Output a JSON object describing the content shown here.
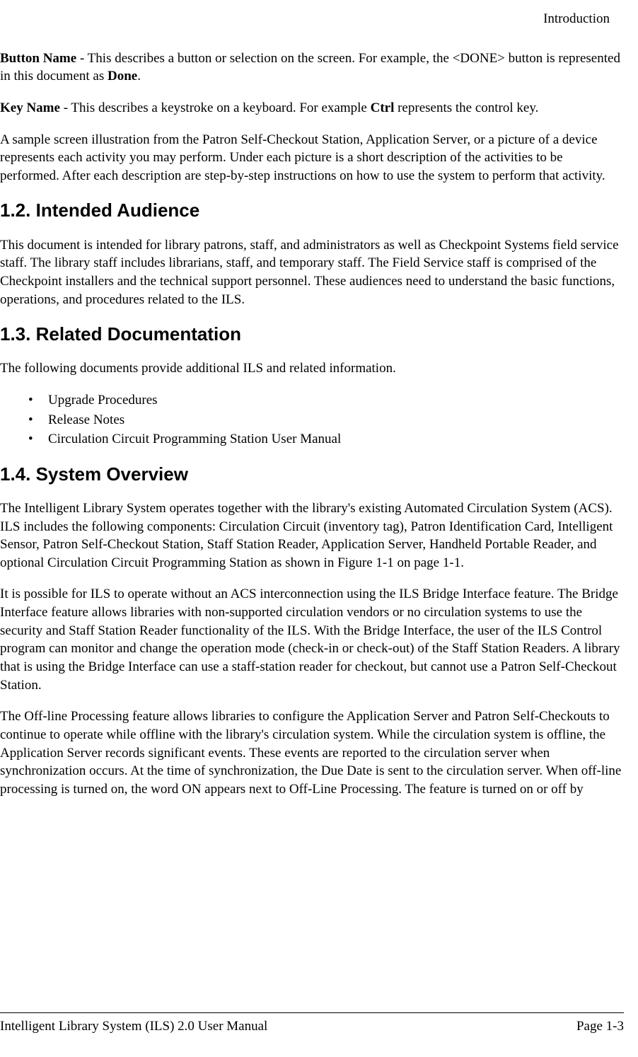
{
  "header": {
    "section": "Introduction"
  },
  "body": {
    "p1_bold1": "Button Name",
    "p1_text1": "  - This describes a button or selection on the screen. For example, the <DONE> button is represented in this document as ",
    "p1_bold2": "Done",
    "p1_text2": ".",
    "p2_bold1": "Key Name",
    "p2_text1": " - This describes a keystroke on a keyboard. For example ",
    "p2_bold2": "Ctrl",
    "p2_text2": " represents the control key.",
    "p3": "A sample screen illustration from the Patron Self-Checkout Station, Application Server, or a picture of a device represents each activity you may perform. Under each picture is a short description of the activities to be performed. After each description are step-by-step instructions on how to use the system to perform that activity.",
    "h_1_2": "1.2.  Intended Audience",
    "p4": "This document is intended for library patrons, staff, and administrators as well as Checkpoint Systems field service staff. The library staff includes librarians, staff, and temporary staff. The Field Service staff is comprised of the Checkpoint installers and the technical support personnel. These audiences need to understand the basic functions, operations, and procedures related to the ILS.",
    "h_1_3": "1.3.  Related Documentation",
    "p5": "The following documents provide additional ILS and related information.",
    "list1": {
      "i1": "Upgrade Procedures",
      "i2": "Release Notes",
      "i3": "Circulation Circuit Programming Station User Manual"
    },
    "h_1_4": "1.4.  System Overview",
    "p6": "The Intelligent Library System operates together with the library's existing Automated Circulation System (ACS). ILS includes the following components: Circulation Circuit (inventory tag), Patron Identification Card, Intelligent Sensor, Patron Self-Checkout Station, Staff Station Reader, Application Server, Handheld Portable Reader, and optional Circulation Circuit Programming Station as shown in Figure 1-1 on page 1-1.",
    "p7": "It is possible for ILS to operate without an ACS interconnection using the ILS Bridge Interface feature. The Bridge Interface feature allows libraries with non-supported circulation vendors or no circulation systems to use the security and Staff Station Reader functionality of the ILS. With the Bridge Interface, the user of the ILS Control program can monitor and change the operation mode (check-in or check-out) of the Staff Station Readers. A library that is using the Bridge Interface can use a staff-station reader for checkout, but cannot use a Patron Self-Checkout Station.",
    "p8": "The Off-line Processing feature allows libraries to configure the Application Server and Patron Self-Checkouts to continue to operate while offline with the library's circulation system. While the circulation system is offline, the Application Server records significant events. These events are reported to the circulation server when synchronization occurs. At the time of synchronization, the Due Date is sent to the circulation server. When off-line processing is turned on, the word ON appears next to Off-Line Processing. The feature is turned on or off by"
  },
  "footer": {
    "left": "Intelligent Library System (ILS) 2.0 User Manual",
    "right": "Page 1-3"
  }
}
